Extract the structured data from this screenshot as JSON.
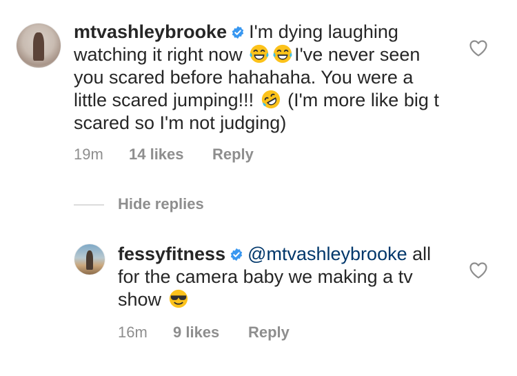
{
  "comments": [
    {
      "username": "mtvashleybrooke",
      "verified": true,
      "text_parts": [
        "I'm dying laughing watching it right now",
        "I've never seen you scared before hahahaha. You were a little scared jumping!!!",
        "(I'm more like big t scared so I'm not judging)"
      ],
      "emojis": [
        "face-with-tears-of-joy-emoji",
        "face-with-tears-of-joy-emoji",
        "rolling-on-floor-laughing-emoji"
      ],
      "time": "19m",
      "likes": "14 likes",
      "reply_label": "Reply"
    },
    {
      "username": "fessyfitness",
      "verified": true,
      "mention": "@mtvashleybrooke",
      "text": "all for the camera baby we making a tv show",
      "emojis": [
        "smiling-face-with-sunglasses-emoji"
      ],
      "time": "16m",
      "likes": "9 likes",
      "reply_label": "Reply"
    }
  ],
  "hide_replies_label": "Hide replies",
  "colors": {
    "text": "#262626",
    "meta": "#8e8e8e",
    "verified": "#3897f0",
    "mention": "#00376b",
    "divider": "#dbdbdb"
  }
}
